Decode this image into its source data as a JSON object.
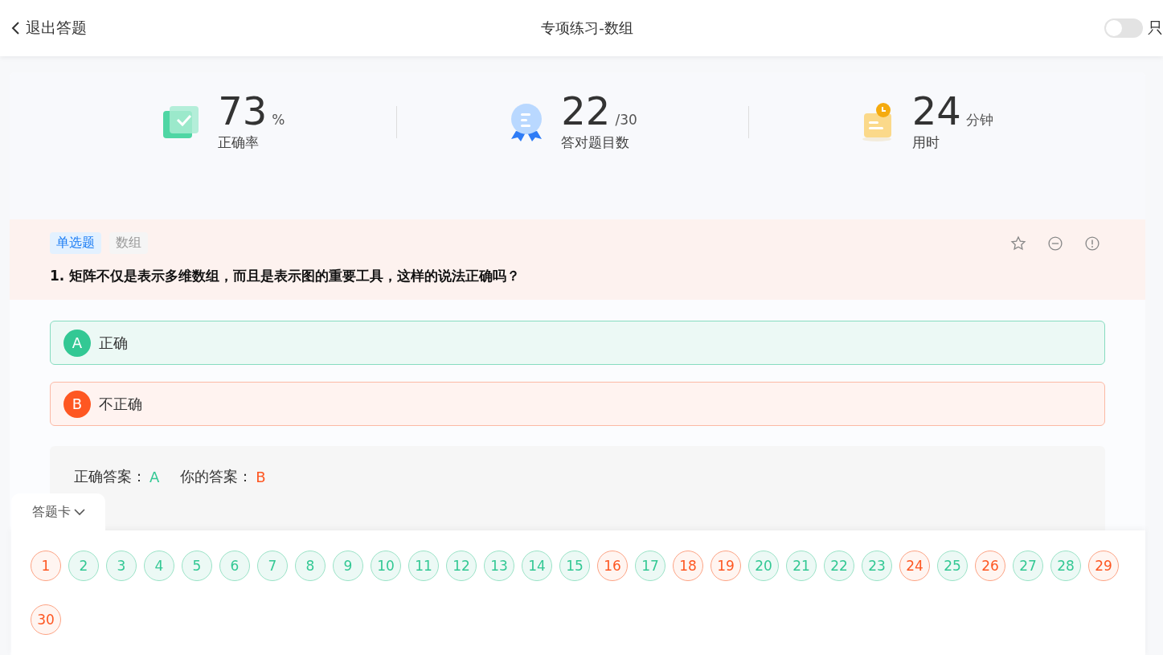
{
  "header": {
    "back": "退出答题",
    "title": "专项练习-数组",
    "toggle": {
      "label": "只",
      "on": false
    }
  },
  "stats": [
    {
      "kind": "accuracy",
      "value": "73",
      "unit": "%",
      "label": "正确率"
    },
    {
      "kind": "count",
      "value": "22",
      "unit": "/30",
      "label": "答对题目数"
    },
    {
      "kind": "time",
      "value": "24",
      "unit": "分钟",
      "label": "用时"
    }
  ],
  "question": {
    "type_tag": "单选题",
    "topic_tag": "数组",
    "number": "1.",
    "text": "矩阵不仅是表示多维数组，而且是表示图的重要工具，这样的说法正确吗？",
    "favorited": false
  },
  "options": [
    {
      "letter": "A",
      "text": "正确",
      "correct": true
    },
    {
      "letter": "B",
      "text": "不正确",
      "correct": false
    }
  ],
  "result": {
    "correct_label": "正确答案：",
    "correct": "A",
    "yours_label": "你的答案：",
    "yours": "B"
  },
  "answer_card": {
    "title": "答题卡",
    "expanded": true,
    "items": [
      {
        "label": "1",
        "correct": false
      },
      {
        "label": "2",
        "correct": true
      },
      {
        "label": "3",
        "correct": true
      },
      {
        "label": "4",
        "correct": true
      },
      {
        "label": "5",
        "correct": true
      },
      {
        "label": "6",
        "correct": true
      },
      {
        "label": "7",
        "correct": true
      },
      {
        "label": "8",
        "correct": true
      },
      {
        "label": "9",
        "correct": true
      },
      {
        "label": "10",
        "correct": true
      },
      {
        "label": "11",
        "correct": true
      },
      {
        "label": "12",
        "correct": true
      },
      {
        "label": "13",
        "correct": true
      },
      {
        "label": "14",
        "correct": true
      },
      {
        "label": "15",
        "correct": true
      },
      {
        "label": "16",
        "correct": false
      },
      {
        "label": "17",
        "correct": true
      },
      {
        "label": "18",
        "correct": false
      },
      {
        "label": "19",
        "correct": false
      },
      {
        "label": "20",
        "correct": true
      },
      {
        "label": "21",
        "correct": true
      },
      {
        "label": "22",
        "correct": true
      },
      {
        "label": "23",
        "correct": true
      },
      {
        "label": "24",
        "correct": false
      },
      {
        "label": "25",
        "correct": true
      },
      {
        "label": "26",
        "correct": false
      },
      {
        "label": "27",
        "correct": true
      },
      {
        "label": "28",
        "correct": true
      },
      {
        "label": "29",
        "correct": false
      },
      {
        "label": "30",
        "correct": false
      }
    ]
  }
}
